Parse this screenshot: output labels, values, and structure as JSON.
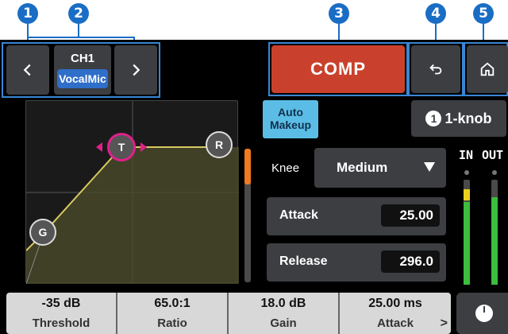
{
  "callouts": [
    "1",
    "2",
    "3",
    "4",
    "5"
  ],
  "channel": {
    "number": "CH1",
    "name": "VocalMic"
  },
  "nav": {
    "prev_icon": "chevron-left-icon",
    "next_icon": "chevron-right-icon"
  },
  "module": {
    "label": "COMP",
    "color": "#c9412c"
  },
  "toolbar": {
    "back_icon": "back-arrow-icon",
    "home_icon": "home-icon"
  },
  "auto_makeup": {
    "label_line1": "Auto",
    "label_line2": "Makeup"
  },
  "one_knob": {
    "number": "1",
    "label": "1-knob"
  },
  "graph": {
    "points": [
      "G",
      "T",
      "R"
    ]
  },
  "knee": {
    "label": "Knee",
    "value": "Medium"
  },
  "attack": {
    "label": "Attack",
    "value": "25.00"
  },
  "release": {
    "label": "Release",
    "value": "296.0"
  },
  "meters": {
    "in_label": "IN",
    "out_label": "OUT"
  },
  "bottom": [
    {
      "value": "-35 dB",
      "label": "Threshold"
    },
    {
      "value": "65.0:1",
      "label": "Ratio"
    },
    {
      "value": "18.0 dB",
      "label": "Gain"
    },
    {
      "value": "25.00 ms",
      "label": "Attack"
    }
  ],
  "more_chevron": ">"
}
